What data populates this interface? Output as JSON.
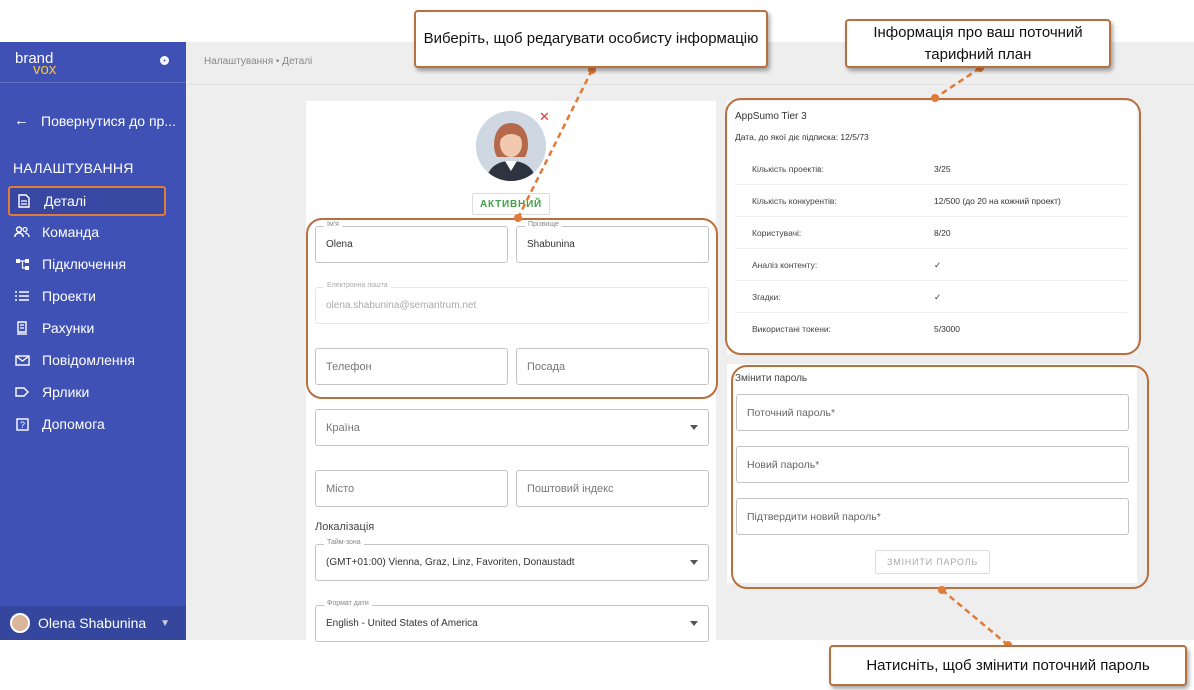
{
  "sidebar": {
    "brand_top": "brand",
    "brand_bottom": "vox",
    "back_label": "Повернутися до пр...",
    "section_title": "НАЛАШТУВАННЯ",
    "items": [
      {
        "label": "Деталі",
        "icon": "document-icon",
        "active": true
      },
      {
        "label": "Команда",
        "icon": "team-icon"
      },
      {
        "label": "Підключення",
        "icon": "connection-icon"
      },
      {
        "label": "Проекти",
        "icon": "list-icon"
      },
      {
        "label": "Рахунки",
        "icon": "invoice-icon"
      },
      {
        "label": "Повідомлення",
        "icon": "mail-icon"
      },
      {
        "label": "Ярлики",
        "icon": "label-icon"
      },
      {
        "label": "Допомога",
        "icon": "help-icon"
      }
    ],
    "user_name": "Olena Shabunina"
  },
  "breadcrumb": "Налаштування • Деталі",
  "profile": {
    "status": "АКТИВНИЙ",
    "first_name_label": "Ім'я",
    "first_name": "Olena",
    "last_name_label": "Прізвище",
    "last_name": "Shabunina",
    "email_label": "Електронна пошта",
    "email": "olena.shabunina@semantrum.net",
    "phone_placeholder": "Телефон",
    "position_placeholder": "Посада",
    "country_placeholder": "Країна",
    "city_placeholder": "Місто",
    "zip_placeholder": "Поштовий індекс",
    "localization_title": "Локалізація",
    "timezone_label": "Тайм-зона",
    "timezone": "(GMT+01:00) Vienna, Graz, Linz, Favoriten, Donaustadt",
    "date_format_label": "Формат дати",
    "date_format": "English - United States of America"
  },
  "plan": {
    "name": "AppSumo Tier 3",
    "expiry": "Дата, до якої діє підписка:  12/5/73",
    "rows": [
      {
        "key": "Кількість проектів:",
        "value": "3/25"
      },
      {
        "key": "Кількість конкурентів:",
        "value": "12/500 (до 20 на кожний проект)"
      },
      {
        "key": "Користувачі:",
        "value": "8/20"
      },
      {
        "key": "Аналіз контенту:",
        "value": "✓"
      },
      {
        "key": "Згадки:",
        "value": "✓"
      },
      {
        "key": "Використані токени:",
        "value": "5/3000"
      }
    ]
  },
  "password": {
    "title": "Змінити пароль",
    "current_placeholder": "Поточний пароль*",
    "new_placeholder": "Новий пароль*",
    "confirm_placeholder": "Підтвердити новий пароль*",
    "button_label": "ЗМІНИТИ ПАРОЛЬ"
  },
  "callouts": {
    "personal_info": "Виберіть, щоб редагувати особисту інформацію",
    "plan_info": "Інформація про ваш поточний тарифний план",
    "change_password": "Натисніть, щоб змінити поточний пароль"
  },
  "colors": {
    "sidebar_bg": "#3f51b5",
    "annotation": "#e07b39",
    "active_green": "#43a047"
  }
}
